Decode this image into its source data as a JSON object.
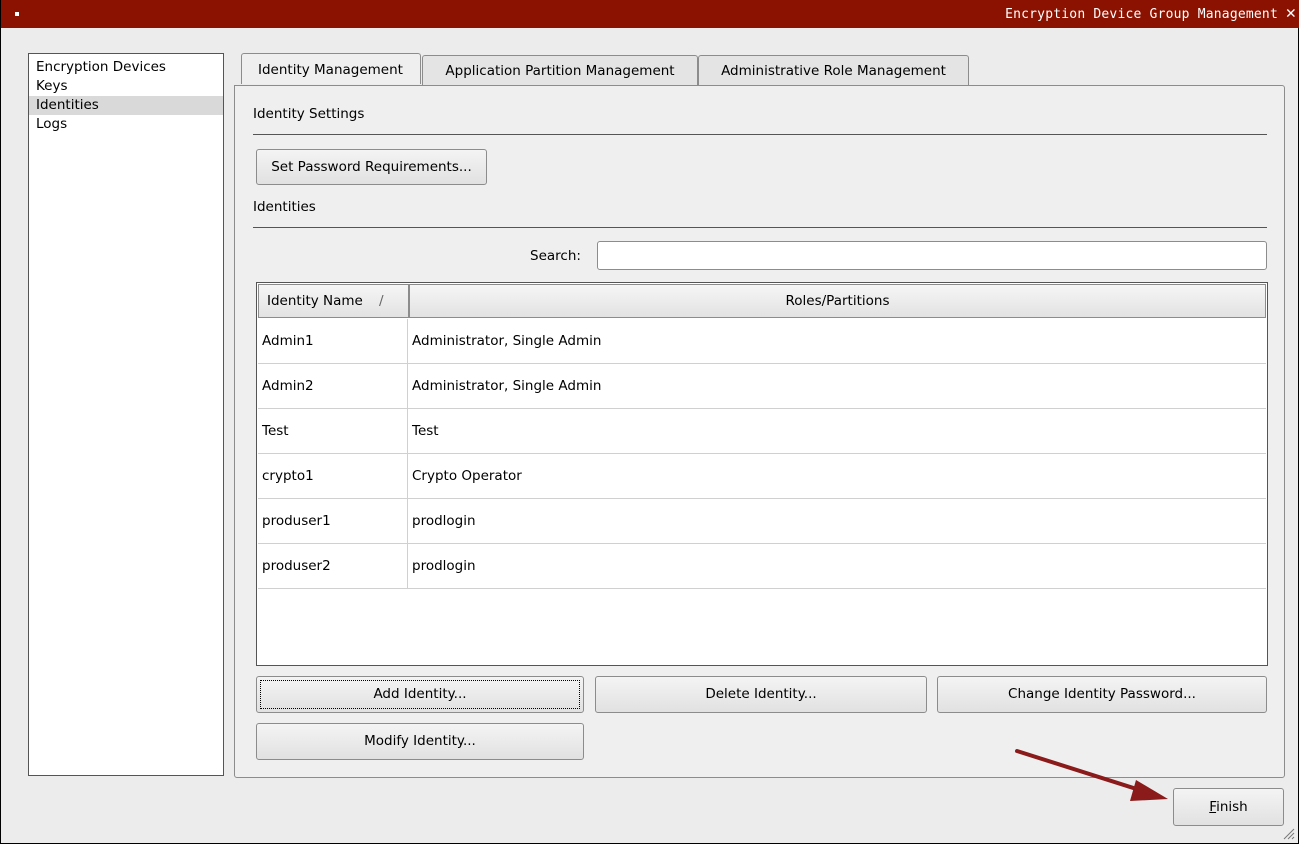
{
  "window": {
    "title": "Encryption Device Group Management"
  },
  "nav": {
    "items": [
      {
        "label": "Encryption Devices",
        "selected": false
      },
      {
        "label": "Keys",
        "selected": false
      },
      {
        "label": "Identities",
        "selected": true
      },
      {
        "label": "Logs",
        "selected": false
      }
    ]
  },
  "tabs": [
    {
      "label": "Identity Management",
      "active": true
    },
    {
      "label": "Application Partition Management",
      "active": false
    },
    {
      "label": "Administrative Role Management",
      "active": false
    }
  ],
  "identity_settings": {
    "heading": "Identity Settings",
    "set_password_button": "Set Password Requirements..."
  },
  "identities": {
    "heading": "Identities",
    "search_label": "Search:",
    "search_value": "",
    "columns": [
      "Identity Name",
      "Roles/Partitions"
    ],
    "sort_indicator": "/",
    "rows": [
      {
        "name": "Admin1",
        "roles": "Administrator, Single Admin"
      },
      {
        "name": "Admin2",
        "roles": "Administrator, Single Admin"
      },
      {
        "name": "Test",
        "roles": "Test"
      },
      {
        "name": "crypto1",
        "roles": "Crypto Operator"
      },
      {
        "name": "produser1",
        "roles": "prodlogin"
      },
      {
        "name": "produser2",
        "roles": "prodlogin"
      }
    ]
  },
  "buttons": {
    "add_identity": "Add Identity...",
    "delete_identity": "Delete Identity...",
    "change_password": "Change Identity Password...",
    "modify_identity": "Modify Identity...",
    "finish_mnemonic": "F",
    "finish_rest": "inish"
  },
  "colors": {
    "titlebar": "#8b1200",
    "annotation_arrow": "#8b1a1a"
  }
}
